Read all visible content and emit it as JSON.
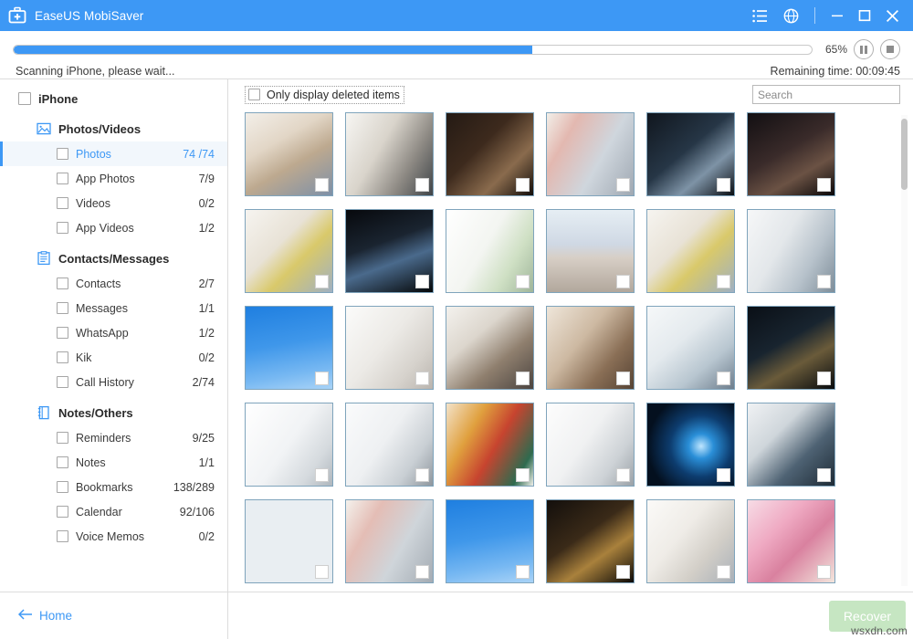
{
  "window": {
    "title": "EaseUS MobiSaver",
    "logo_icon": "first-aid-kit-icon",
    "menu_icon": "list-menu-icon",
    "globe_icon": "globe-icon",
    "minimize_icon": "minimize-icon",
    "maximize_icon": "maximize-icon",
    "close_icon": "close-icon",
    "accent_color": "#3d98f5"
  },
  "progress": {
    "percent_label": "65%",
    "percent_value": 65,
    "status_text": "Scanning iPhone, please wait...",
    "remaining_text": "Remaining time: 00:09:45",
    "pause_icon": "pause-icon",
    "stop_icon": "stop-icon",
    "bar_color": "#3d98f5"
  },
  "sidebar": {
    "root": {
      "label": "iPhone",
      "checked": false
    },
    "groups": [
      {
        "label": "Photos/Videos",
        "icon": "photo-icon",
        "items": [
          {
            "label": "Photos",
            "count": "74 /74",
            "selected": true
          },
          {
            "label": "App Photos",
            "count": "7/9",
            "selected": false
          },
          {
            "label": "Videos",
            "count": "0/2",
            "selected": false
          },
          {
            "label": "App Videos",
            "count": "1/2",
            "selected": false
          }
        ]
      },
      {
        "label": "Contacts/Messages",
        "icon": "clipboard-icon",
        "items": [
          {
            "label": "Contacts",
            "count": "2/7",
            "selected": false
          },
          {
            "label": "Messages",
            "count": "1/1",
            "selected": false
          },
          {
            "label": "WhatsApp",
            "count": "1/2",
            "selected": false
          },
          {
            "label": "Kik",
            "count": "0/2",
            "selected": false
          },
          {
            "label": "Call History",
            "count": "2/74",
            "selected": false
          }
        ]
      },
      {
        "label": "Notes/Others",
        "icon": "notebook-icon",
        "items": [
          {
            "label": "Reminders",
            "count": "9/25",
            "selected": false
          },
          {
            "label": "Notes",
            "count": "1/1",
            "selected": false
          },
          {
            "label": "Bookmarks",
            "count": "138/289",
            "selected": false
          },
          {
            "label": "Calendar",
            "count": "92/106",
            "selected": false
          },
          {
            "label": "Voice Memos",
            "count": "0/2",
            "selected": false
          }
        ]
      }
    ],
    "home_label": "Home",
    "home_arrow_icon": "arrow-left-icon"
  },
  "toolbar": {
    "only_deleted_label": "Only display deleted items",
    "only_deleted_checked": false,
    "search_placeholder": "Search",
    "search_value": ""
  },
  "gallery": {
    "columns": 6,
    "thumbnails": [
      {
        "id": 1,
        "desc": "family at laptop in bright kitchen",
        "checked": false,
        "art": "fam-kitchen"
      },
      {
        "id": 2,
        "desc": "two women at white office desk",
        "checked": false,
        "art": "office-white"
      },
      {
        "id": 3,
        "desc": "woman with mug in dark room",
        "checked": false,
        "art": "dark-warm"
      },
      {
        "id": 4,
        "desc": "man reading near red bookshelf",
        "checked": false,
        "art": "library-red"
      },
      {
        "id": 5,
        "desc": "woman at laptop in dark interior",
        "checked": false,
        "art": "dark-cool"
      },
      {
        "id": 6,
        "desc": "woman using tablet, dark cafe",
        "checked": false,
        "art": "dark-night"
      },
      {
        "id": 7,
        "desc": "girl hugging grandmother, tulips",
        "checked": false,
        "art": "tulips"
      },
      {
        "id": 8,
        "desc": "man at laptop, city lights at night",
        "checked": false,
        "art": "night-city"
      },
      {
        "id": 9,
        "desc": "bright living room with plant",
        "checked": false,
        "art": "bright-room"
      },
      {
        "id": 10,
        "desc": "wooden table, blurred celebration",
        "checked": false,
        "art": "wood-bokeh"
      },
      {
        "id": 11,
        "desc": "girl hugging grandmother, tulips",
        "checked": false,
        "art": "tulips"
      },
      {
        "id": 12,
        "desc": "man at desk with laptop, shelves",
        "checked": false,
        "art": "shelf-desk"
      },
      {
        "id": 13,
        "desc": "blue sky with clouds",
        "checked": false,
        "art": "blue-sky"
      },
      {
        "id": 14,
        "desc": "empty bright interior",
        "checked": false,
        "art": "pale-room"
      },
      {
        "id": 15,
        "desc": "smiling man with laptop",
        "checked": false,
        "art": "man-laptop"
      },
      {
        "id": 16,
        "desc": "team meeting at office table",
        "checked": false,
        "art": "meeting"
      },
      {
        "id": 17,
        "desc": "two businessmen with documents",
        "checked": false,
        "art": "two-men"
      },
      {
        "id": 18,
        "desc": "people in office at night, skyline",
        "checked": false,
        "art": "night-office"
      },
      {
        "id": 19,
        "desc": "woman at window, white office",
        "checked": false,
        "art": "white-window"
      },
      {
        "id": 20,
        "desc": "two people talking in white hall",
        "checked": false,
        "art": "white-hall"
      },
      {
        "id": 21,
        "desc": "woman with red umbrella",
        "checked": false,
        "art": "umbrella"
      },
      {
        "id": 22,
        "desc": "two people handshake, bright hall",
        "checked": false,
        "art": "handshake"
      },
      {
        "id": 23,
        "desc": "blue glowing earth in space",
        "checked": false,
        "art": "space-earth"
      },
      {
        "id": 24,
        "desc": "team gathered around computer",
        "checked": false,
        "art": "team-screen"
      },
      {
        "id": 25,
        "desc": "office meeting, people at table",
        "checked": false,
        "art": "meeting2"
      },
      {
        "id": 26,
        "desc": "man reading near bookshelf",
        "checked": false,
        "art": "library-red2"
      },
      {
        "id": 27,
        "desc": "blue sky with clouds",
        "checked": false,
        "art": "blue-sky"
      },
      {
        "id": 28,
        "desc": "woman in dark restaurant with lights",
        "checked": false,
        "art": "dark-lights"
      },
      {
        "id": 29,
        "desc": "couple with flowers, white brick",
        "checked": false,
        "art": "white-brick"
      },
      {
        "id": 30,
        "desc": "pink roses with Valentine card",
        "checked": false,
        "art": "roses"
      }
    ],
    "scrollbar_position": "top"
  },
  "footer": {
    "recover_label": "Recover",
    "recover_enabled": false,
    "recover_color": "#c6e6c2",
    "watermark": "wsxdn.com"
  }
}
